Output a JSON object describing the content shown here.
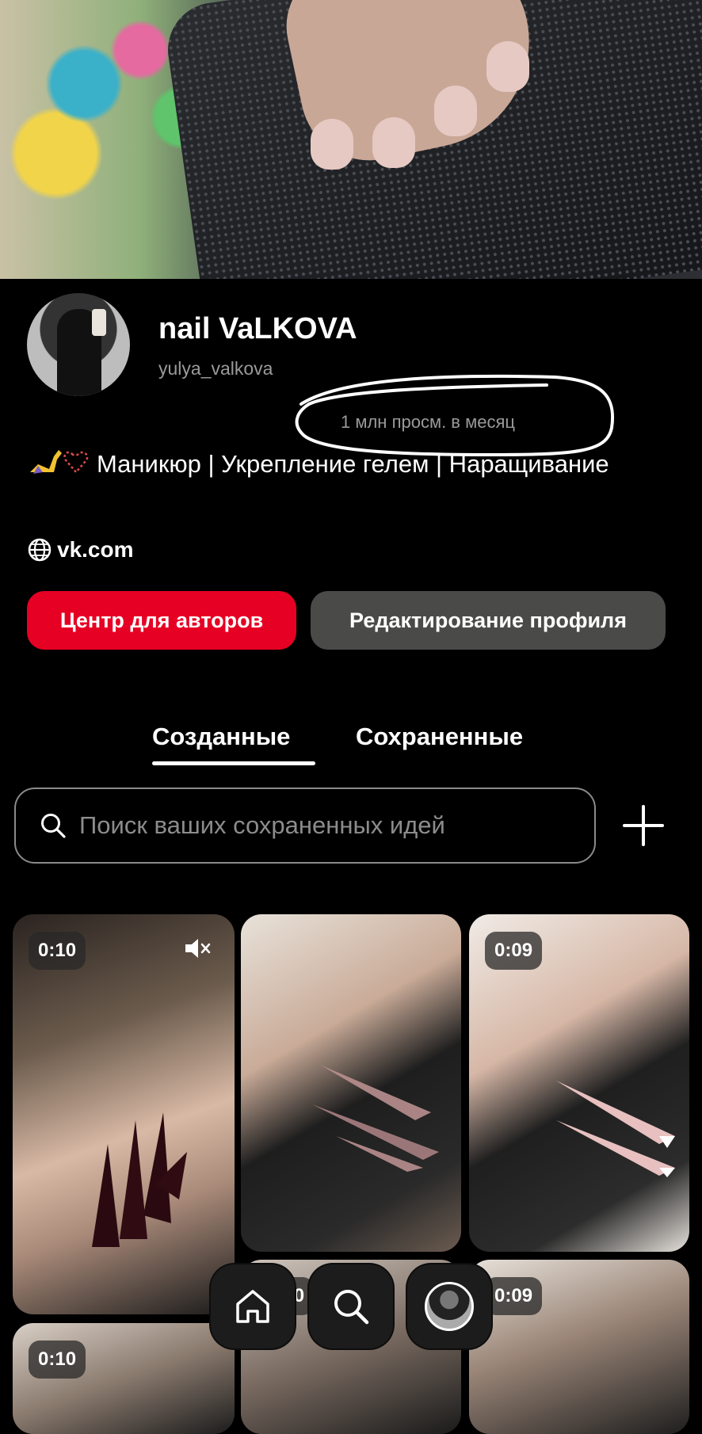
{
  "profile": {
    "display_name": "nail VaLKOVA",
    "username": "yulya_valkova",
    "views": "1 млн просм. в месяц",
    "bio": "Маникюр | Укрепление гелем | Наращивание",
    "link": "vk.com"
  },
  "actions": {
    "creator_hub": "Центр для авторов",
    "edit_profile": "Редактирование профиля"
  },
  "tabs": [
    {
      "label": "Созданные",
      "active": true
    },
    {
      "label": "Сохраненные",
      "active": false
    }
  ],
  "search": {
    "placeholder": "Поиск ваших сохраненных идей"
  },
  "pins": [
    {
      "duration": "0:10",
      "muted": true
    },
    {
      "duration": ""
    },
    {
      "duration": "0:09"
    },
    {
      "duration": "0:10"
    },
    {
      "duration": "0:09"
    },
    {
      "duration": "0:10"
    }
  ],
  "colors": {
    "accent": "#e60023",
    "secondary_button": "#4a4b48",
    "muted_text": "#9a9a9a"
  },
  "bottom_nav": [
    {
      "icon": "home-icon"
    },
    {
      "icon": "search-icon"
    },
    {
      "icon": "profile-avatar-icon"
    }
  ]
}
